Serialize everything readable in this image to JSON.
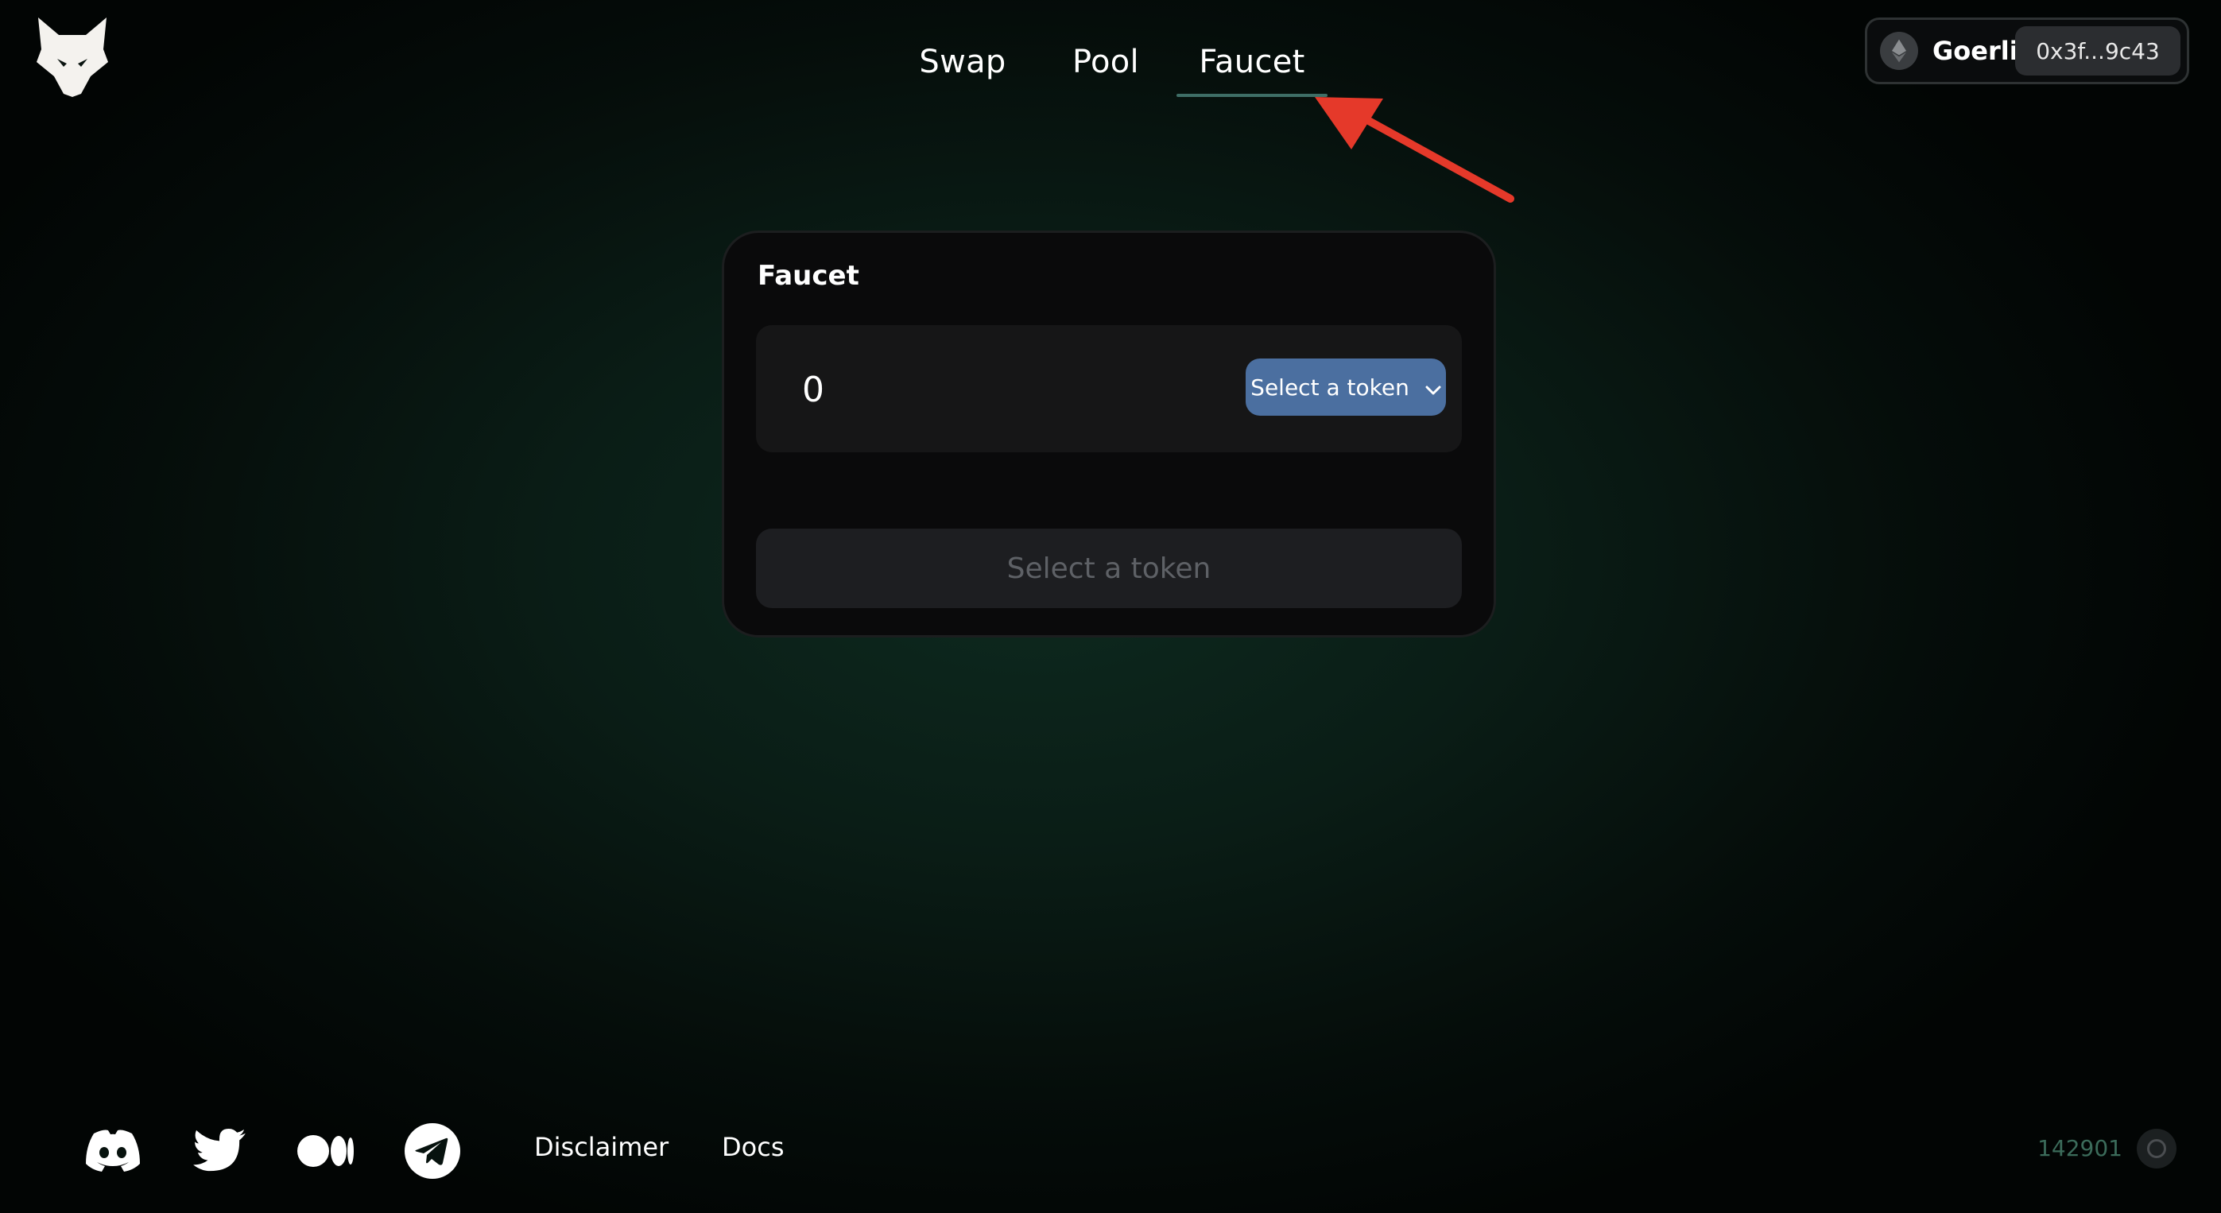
{
  "nav": {
    "tabs": [
      {
        "label": "Swap"
      },
      {
        "label": "Pool"
      },
      {
        "label": "Faucet"
      }
    ]
  },
  "wallet": {
    "network": "Goerli",
    "address": "0x3f...9c43"
  },
  "faucet": {
    "title": "Faucet",
    "amount_value": "0",
    "token_select_label": "Select a token",
    "action_button_label": "Select a token"
  },
  "footer": {
    "links": [
      {
        "label": "Disclaimer"
      },
      {
        "label": "Docs"
      }
    ],
    "block_number": "142901"
  },
  "icons": {
    "logo": "lynx-logo-icon",
    "network": "ethereum-icon",
    "select": "chevron-down-icon",
    "social": [
      "discord-icon",
      "twitter-icon",
      "medium-icon",
      "telegram-icon"
    ]
  },
  "colors": {
    "accent": "#4b6fa0",
    "tab_underline": "#3e6e66",
    "arrow": "#e5392a",
    "block_number": "#3b6b5a"
  }
}
